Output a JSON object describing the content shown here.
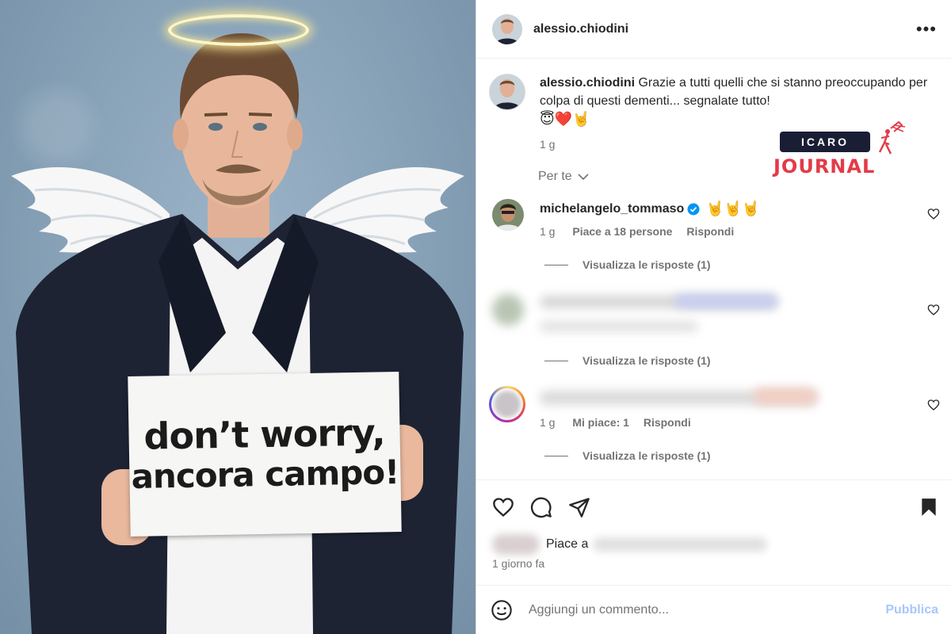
{
  "photo": {
    "sign_line1": "don’t worry,",
    "sign_line2": "ancora campo!"
  },
  "header": {
    "username": "alessio.chiodini",
    "more_icon": "more-horizontal-icon"
  },
  "caption": {
    "username": "alessio.chiodini",
    "text": "Grazie a tutti quelli che si stanno preoccupando per colpa di questi dementi... segnalate tutto!",
    "emojis": "😇❤️🤘",
    "age": "1 g",
    "translation_toggle": "Per te"
  },
  "comments": [
    {
      "username": "michelangelo_tommaso",
      "verified": true,
      "text": "🤘🤘🤘",
      "age": "1 g",
      "likes": "Piace a 18 persone",
      "reply": "Rispondi",
      "view_replies": "Visualizza le risposte (1)"
    },
    {
      "view_replies": "Visualizza le risposte (1)"
    },
    {
      "age": "1 g",
      "likes": "Mi piace: 1",
      "reply": "Rispondi",
      "view_replies": "Visualizza le risposte (1)"
    }
  ],
  "likes_prefix": "Piace a",
  "date": "1 giorno fa",
  "add_comment": {
    "placeholder": "Aggiungi un commento...",
    "publish": "Pubblica"
  },
  "watermark": {
    "top": "ICARO",
    "bottom": "JOURNAL"
  },
  "colors": {
    "link_disabled": "#a8c7fa",
    "verified": "#0095f6",
    "watermark_red": "#e23b48",
    "watermark_navy": "#1a1e34"
  }
}
